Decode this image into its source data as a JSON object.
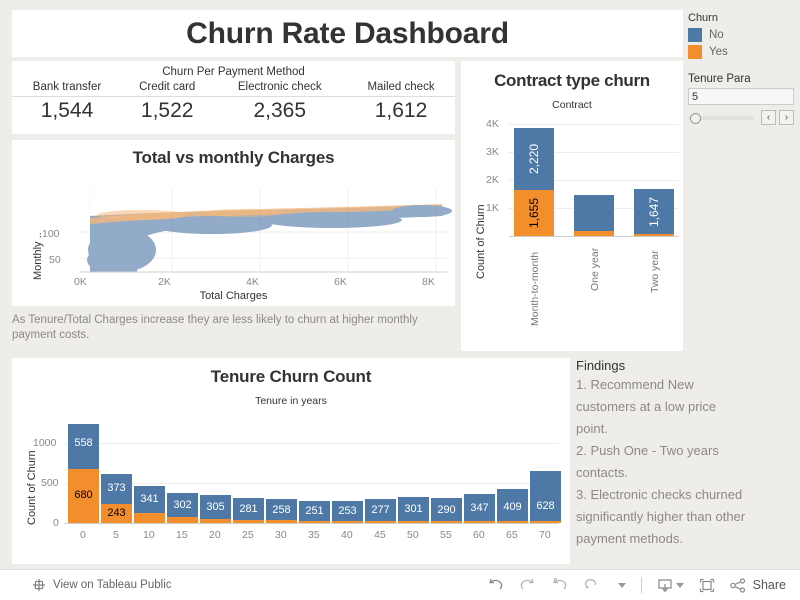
{
  "header": {
    "title": "Churn Rate Dashboard"
  },
  "payment": {
    "caption": "Churn Per Payment Method",
    "columns": [
      "Bank transfer",
      "Credit card",
      "Electronic check",
      "Mailed check"
    ],
    "values": [
      "1,544",
      "1,522",
      "2,365",
      "1,612"
    ]
  },
  "scatter": {
    "title": "Total vs monthly Charges",
    "ylabel": "Monthly ..",
    "xlabel": "Total Charges",
    "yticks": [
      "100",
      "50"
    ],
    "xticks": [
      "0K",
      "2K",
      "4K",
      "6K",
      "8K"
    ],
    "note": "As Tenure/Total Charges increase they are less likely to churn at higher monthly payment costs."
  },
  "contract": {
    "title": "Contract type churn",
    "column_header": "Contract",
    "ylabel": "Count of Churn",
    "yticks": [
      "4K",
      "3K",
      "2K",
      "1K"
    ]
  },
  "tenure": {
    "title": "Tenure Churn Count",
    "column_header": "Tenure in years",
    "ylabel": "Count of Churn",
    "yticks": [
      "1000",
      "500",
      "0"
    ]
  },
  "findings": {
    "title": "Findings",
    "lines": [
      "1. Recommend New",
      "customers at a low price",
      "point.",
      "2. Push One - Two years",
      "contacts.",
      "3. Electronic checks churned",
      "significantly higher than other",
      "payment methods."
    ]
  },
  "legend": {
    "title": "Churn",
    "items": [
      {
        "label": "No",
        "color": "#4E79A7"
      },
      {
        "label": "Yes",
        "color": "#F28E2B"
      }
    ]
  },
  "parameter": {
    "title": "Tenure Para",
    "value": "5",
    "prev_label": "‹",
    "next_label": "›"
  },
  "toolbar": {
    "tableau_link": "View on Tableau Public",
    "share_label": "Share",
    "icons": [
      "undo-icon",
      "redo-icon",
      "revert-icon",
      "refresh-icon",
      "pause-icon",
      "download-icon",
      "fullscreen-icon",
      "share-icon"
    ]
  },
  "colors": {
    "blue": "#4E79A7",
    "orange": "#F28E2B",
    "background": "#EFEDE9",
    "panel": "#FFFFFF"
  },
  "chart_data": [
    {
      "type": "bar",
      "title": "Contract type churn",
      "xlabel": "Contract",
      "ylabel": "Count of Churn",
      "categories": [
        "Month-to-month",
        "One year",
        "Two year"
      ],
      "series": [
        {
          "name": "Yes",
          "color": "#F28E2B",
          "values": [
            1655,
            166,
            48
          ]
        },
        {
          "name": "No",
          "color": "#4E79A7",
          "values": [
            2220,
            1307,
            1647
          ]
        }
      ],
      "labels": {
        "Month-to-month": [
          "1,655",
          "2,220"
        ],
        "One year": [
          "",
          ""
        ],
        "Two year": [
          "",
          "1,647"
        ]
      },
      "ylim": [
        0,
        4400
      ],
      "yticks": [
        1000,
        2000,
        3000,
        4000
      ],
      "ytick_labels": [
        "1K",
        "2K",
        "3K",
        "4K"
      ],
      "stacked": true,
      "grid": true,
      "legend_position": "right"
    },
    {
      "type": "bar",
      "title": "Tenure Churn Count",
      "xlabel": "Tenure in years",
      "ylabel": "Count of Churn",
      "categories": [
        "0",
        "5",
        "10",
        "15",
        "20",
        "25",
        "30",
        "35",
        "40",
        "45",
        "50",
        "55",
        "60",
        "65",
        "70"
      ],
      "series": [
        {
          "name": "Yes",
          "color": "#F28E2B",
          "values": [
            680,
            243,
            130,
            75,
            50,
            37,
            32,
            28,
            25,
            24,
            22,
            22,
            20,
            25,
            24
          ]
        },
        {
          "name": "No",
          "color": "#4E79A7",
          "values": [
            558,
            373,
            341,
            302,
            305,
            281,
            258,
            251,
            253,
            277,
            301,
            290,
            347,
            409,
            628
          ]
        }
      ],
      "blue_labels": [
        "558",
        "373",
        "341",
        "302",
        "305",
        "281",
        "258",
        "251",
        "253",
        "277",
        "301",
        "290",
        "347",
        "409",
        "628"
      ],
      "orange_labels": [
        "680",
        "243",
        "",
        "",
        "",
        "",
        "",
        "",
        "",
        "",
        "",
        "",
        "",
        "",
        ""
      ],
      "ylim": [
        0,
        1300
      ],
      "yticks": [
        0,
        500,
        1000
      ],
      "ytick_labels": [
        "0",
        "500",
        "1000"
      ],
      "stacked": true,
      "grid": true,
      "legend_position": "right"
    },
    {
      "type": "scatter",
      "title": "Total vs monthly Charges",
      "xlabel": "Total Charges",
      "ylabel": "Monthly ..",
      "xlim": [
        0,
        8800
      ],
      "ylim": [
        18,
        120
      ],
      "xticks": [
        0,
        2000,
        4000,
        6000,
        8000
      ],
      "xtick_labels": [
        "0K",
        "2K",
        "4K",
        "6K",
        "8K"
      ],
      "yticks": [
        50,
        100
      ],
      "ytick_labels": [
        "50",
        "100"
      ],
      "series": [
        {
          "name": "No",
          "color": "#4E79A7"
        },
        {
          "name": "Yes",
          "color": "#F28E2B"
        }
      ],
      "grid": true,
      "legend_position": "right"
    },
    {
      "type": "table",
      "title": "Churn Per Payment Method",
      "columns": [
        "Bank transfer",
        "Credit card",
        "Electronic check",
        "Mailed check"
      ],
      "values": [
        1544,
        1522,
        2365,
        1612
      ]
    }
  ]
}
